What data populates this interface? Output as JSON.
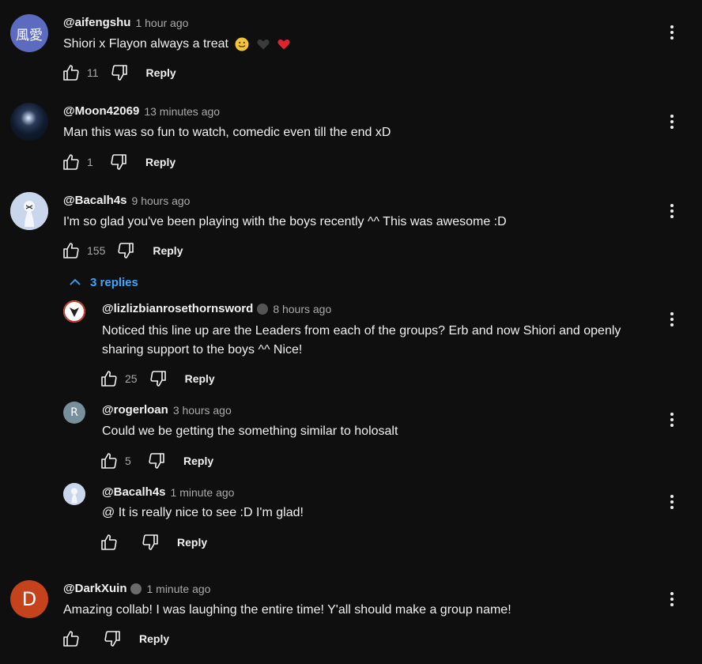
{
  "comments": [
    {
      "author": "@aifengshu",
      "time": "1 hour ago",
      "text": "Shiori x Flayon always a treat",
      "likes": "11",
      "reply": "Reply",
      "avatar_text": "風愛",
      "avatar_color": "#5c6bc0"
    },
    {
      "author": "@Moon42069",
      "time": "13 minutes ago",
      "text": "Man this was so fun to watch, comedic even till the end xD",
      "likes": "1",
      "reply": "Reply"
    },
    {
      "author": "@Bacalh4s",
      "time": "9 hours ago",
      "text": "I'm so glad you've been playing with the boys recently ^^ This was awesome :D",
      "likes": "155",
      "reply": "Reply"
    },
    {
      "author": "@DarkXuin",
      "time": "1 minute ago",
      "text": "Amazing collab! I was laughing the entire time! Y'all should make a group name!",
      "likes": "",
      "reply": "Reply",
      "avatar_text": "D",
      "avatar_color": "#c4421c"
    }
  ],
  "replies_toggle": "3 replies",
  "replies": [
    {
      "author": "@lizlizbianrosethornsword",
      "time": "8 hours ago",
      "text_lines": [
        "Noticed this line up are the Leaders from each of the groups? Erb and now Shiori and openly",
        "sharing support to the boys ^^ Nice!"
      ],
      "likes": "25",
      "reply": "Reply"
    },
    {
      "author": "@rogerloan",
      "time": "3 hours ago",
      "text": "Could we be getting the something similar to holosalt",
      "likes": "5",
      "reply": "Reply",
      "avatar_text": "R",
      "avatar_color": "#78909c"
    },
    {
      "author": "@Bacalh4s",
      "time": "1 minute ago",
      "text": "@ It is really nice to see :D I'm glad!",
      "likes": "",
      "reply": "Reply"
    }
  ],
  "colors": {
    "background": "#0f0f0f",
    "text": "#f1f1f1",
    "muted": "#aaaaaa",
    "link": "#3ea6ff"
  },
  "icons": [
    "thumb-up-icon",
    "thumb-down-icon",
    "more-vert-icon",
    "chevron-up-icon",
    "heart-emoji",
    "smile-emoji",
    "member-badge-icon"
  ]
}
